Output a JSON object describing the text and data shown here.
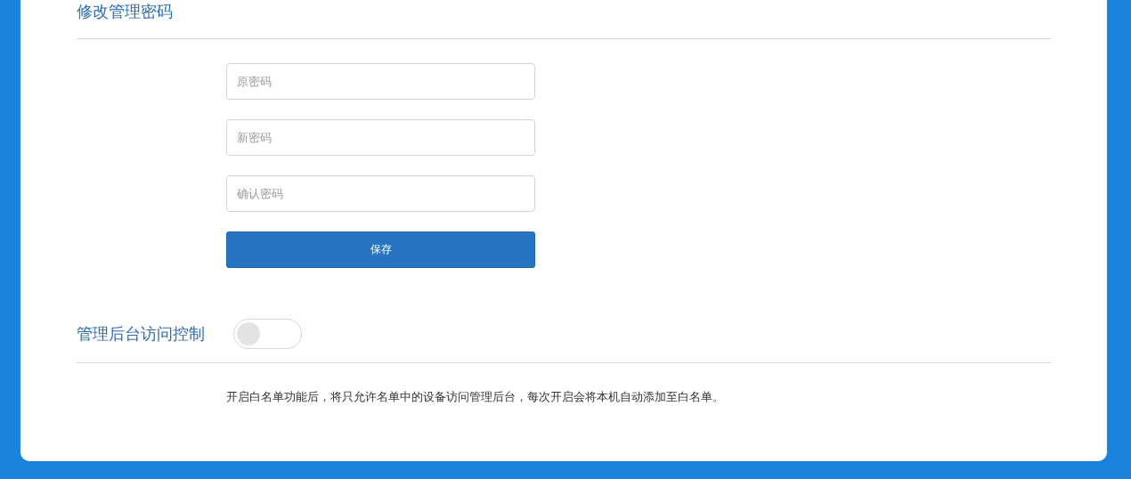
{
  "password_section": {
    "title": "修改管理密码",
    "fields": [
      {
        "placeholder": "原密码"
      },
      {
        "placeholder": "新密码"
      },
      {
        "placeholder": "确认密码"
      }
    ],
    "save_button": "保存"
  },
  "access_section": {
    "title": "管理后台访问控制",
    "toggle": {
      "on": false
    },
    "note": "开启白名单功能后，将只允许名单中的设备访问管理后台，每次开启会将本机自动添加至白名单。"
  }
}
